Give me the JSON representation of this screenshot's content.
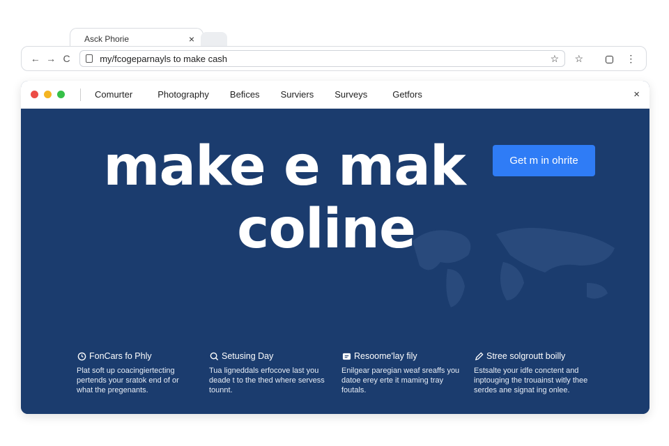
{
  "browser": {
    "tab_title": "Asck Phorie",
    "tab_close": "×",
    "nav": {
      "back": "←",
      "forward": "→",
      "reload": "C"
    },
    "url": "my/fcogeparnayls to make cash",
    "bookmark": "☆",
    "menu": "⋮"
  },
  "window": {
    "menu": [
      "Comurter",
      "Photography",
      "Befices",
      "Surviers",
      "Surveys",
      "Getfors"
    ],
    "close": "×"
  },
  "hero": {
    "headline_line1": "make e mak",
    "headline_line2": "coline",
    "cta_label": "Get m in ohrite"
  },
  "features": [
    {
      "icon": "clock-icon",
      "title": "FonCars fo Phly",
      "body": "Plat soft up coacingiertecting pertends your sratok end of or what the pregenants."
    },
    {
      "icon": "search-icon",
      "title": "Setusing Day",
      "body": "Tua ligneddals erfocove last you deade t to the thed where servess tounnt."
    },
    {
      "icon": "chat-icon",
      "title": "Resoome'lay fily",
      "body": "Enilgear paregian weaf sreaffs you datoe erey erte it maming tray foutals."
    },
    {
      "icon": "pencil-icon",
      "title": "Stree solgroutt boilly",
      "body": "Estsalte your idfe conctent and inptouging the trouainst witly thee serdes ane signat ing onlee."
    }
  ],
  "colors": {
    "hero_bg": "#1b3c6e",
    "cta": "#2f7cf6"
  }
}
